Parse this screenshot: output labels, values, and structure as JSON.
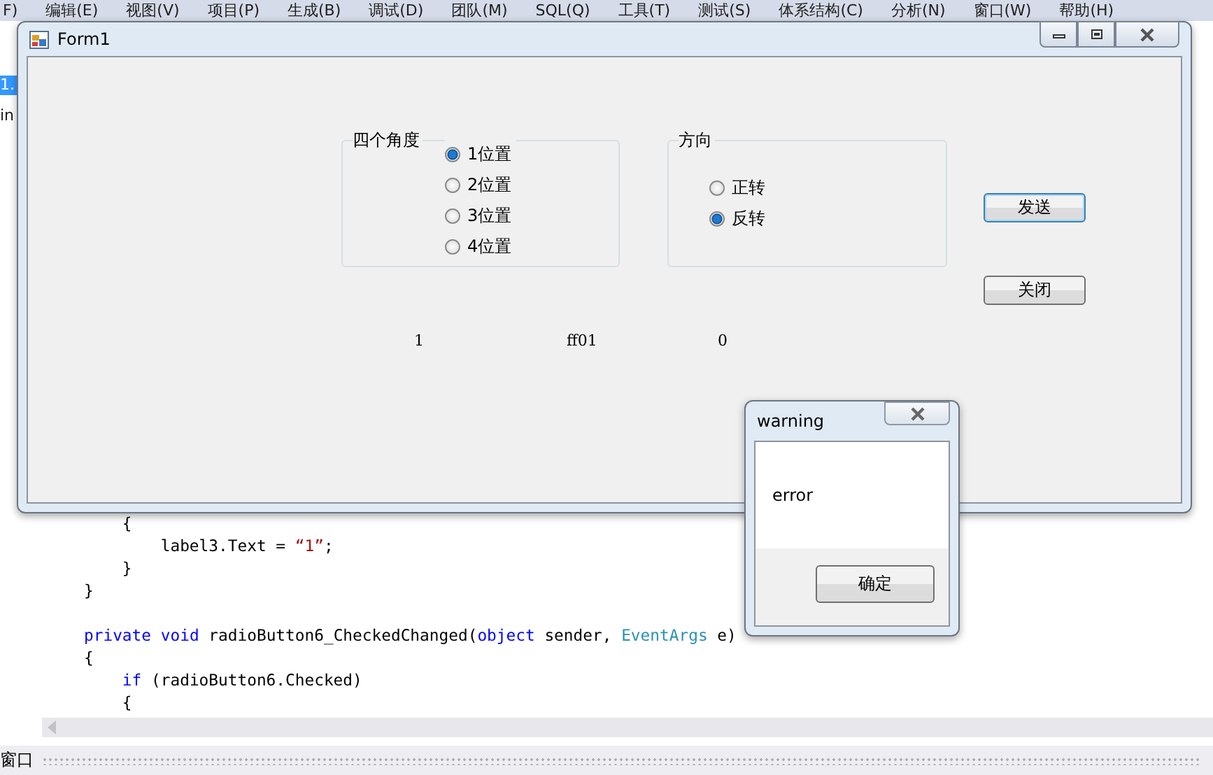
{
  "ide_menu": [
    "F)",
    "编辑(E)",
    "视图(V)",
    "项目(P)",
    "生成(B)",
    "调试(D)",
    "团队(M)",
    "SQL(Q)",
    "工具(T)",
    "测试(S)",
    "体系结构(C)",
    "分析(N)",
    "窗口(W)",
    "帮助(H)"
  ],
  "ide_fragments": [
    "1.",
    "in"
  ],
  "code_lines": [
    [
      {
        "t": "    {",
        "kind": "plain"
      }
    ],
    [
      {
        "t": "        label3.Text = ",
        "kind": "plain"
      },
      {
        "t": "“1”",
        "kind": "string"
      },
      {
        "t": ";",
        "kind": "plain"
      }
    ],
    [
      {
        "t": "    }",
        "kind": "plain"
      }
    ],
    [
      {
        "t": "}",
        "kind": "plain"
      }
    ],
    [
      {
        "t": "private",
        "kind": "keyword"
      },
      {
        "t": " void",
        "kind": "keyword"
      },
      {
        "t": " radioButton6_CheckedChanged(",
        "kind": "plain"
      },
      {
        "t": "object",
        "kind": "keyword"
      },
      {
        "t": " sender, ",
        "kind": "plain"
      },
      {
        "t": "EventArgs",
        "kind": "type"
      },
      {
        "t": " e)",
        "kind": "plain"
      }
    ],
    [
      {
        "t": "{",
        "kind": "plain"
      }
    ],
    [
      {
        "t": "    if",
        "kind": "keyword"
      },
      {
        "t": " (radioButton6.Checked)",
        "kind": "plain"
      }
    ],
    [
      {
        "t": "    {",
        "kind": "plain"
      }
    ]
  ],
  "bottom_panel": {
    "title": "窗口"
  },
  "form": {
    "title": "Form1",
    "groups": [
      {
        "title": "四个角度",
        "options": [
          {
            "label": "1位置",
            "selected": true
          },
          {
            "label": "2位置",
            "selected": false
          },
          {
            "label": "3位置",
            "selected": false
          },
          {
            "label": "4位置",
            "selected": false
          }
        ]
      },
      {
        "title": "方向",
        "options": [
          {
            "label": "正转",
            "selected": false
          },
          {
            "label": "反转",
            "selected": true
          }
        ]
      }
    ],
    "buttons": [
      "发送",
      "关闭"
    ],
    "labels": [
      "1",
      "ff01",
      "0"
    ]
  },
  "dialog": {
    "title": "warning",
    "message": "error",
    "button": "确定"
  }
}
